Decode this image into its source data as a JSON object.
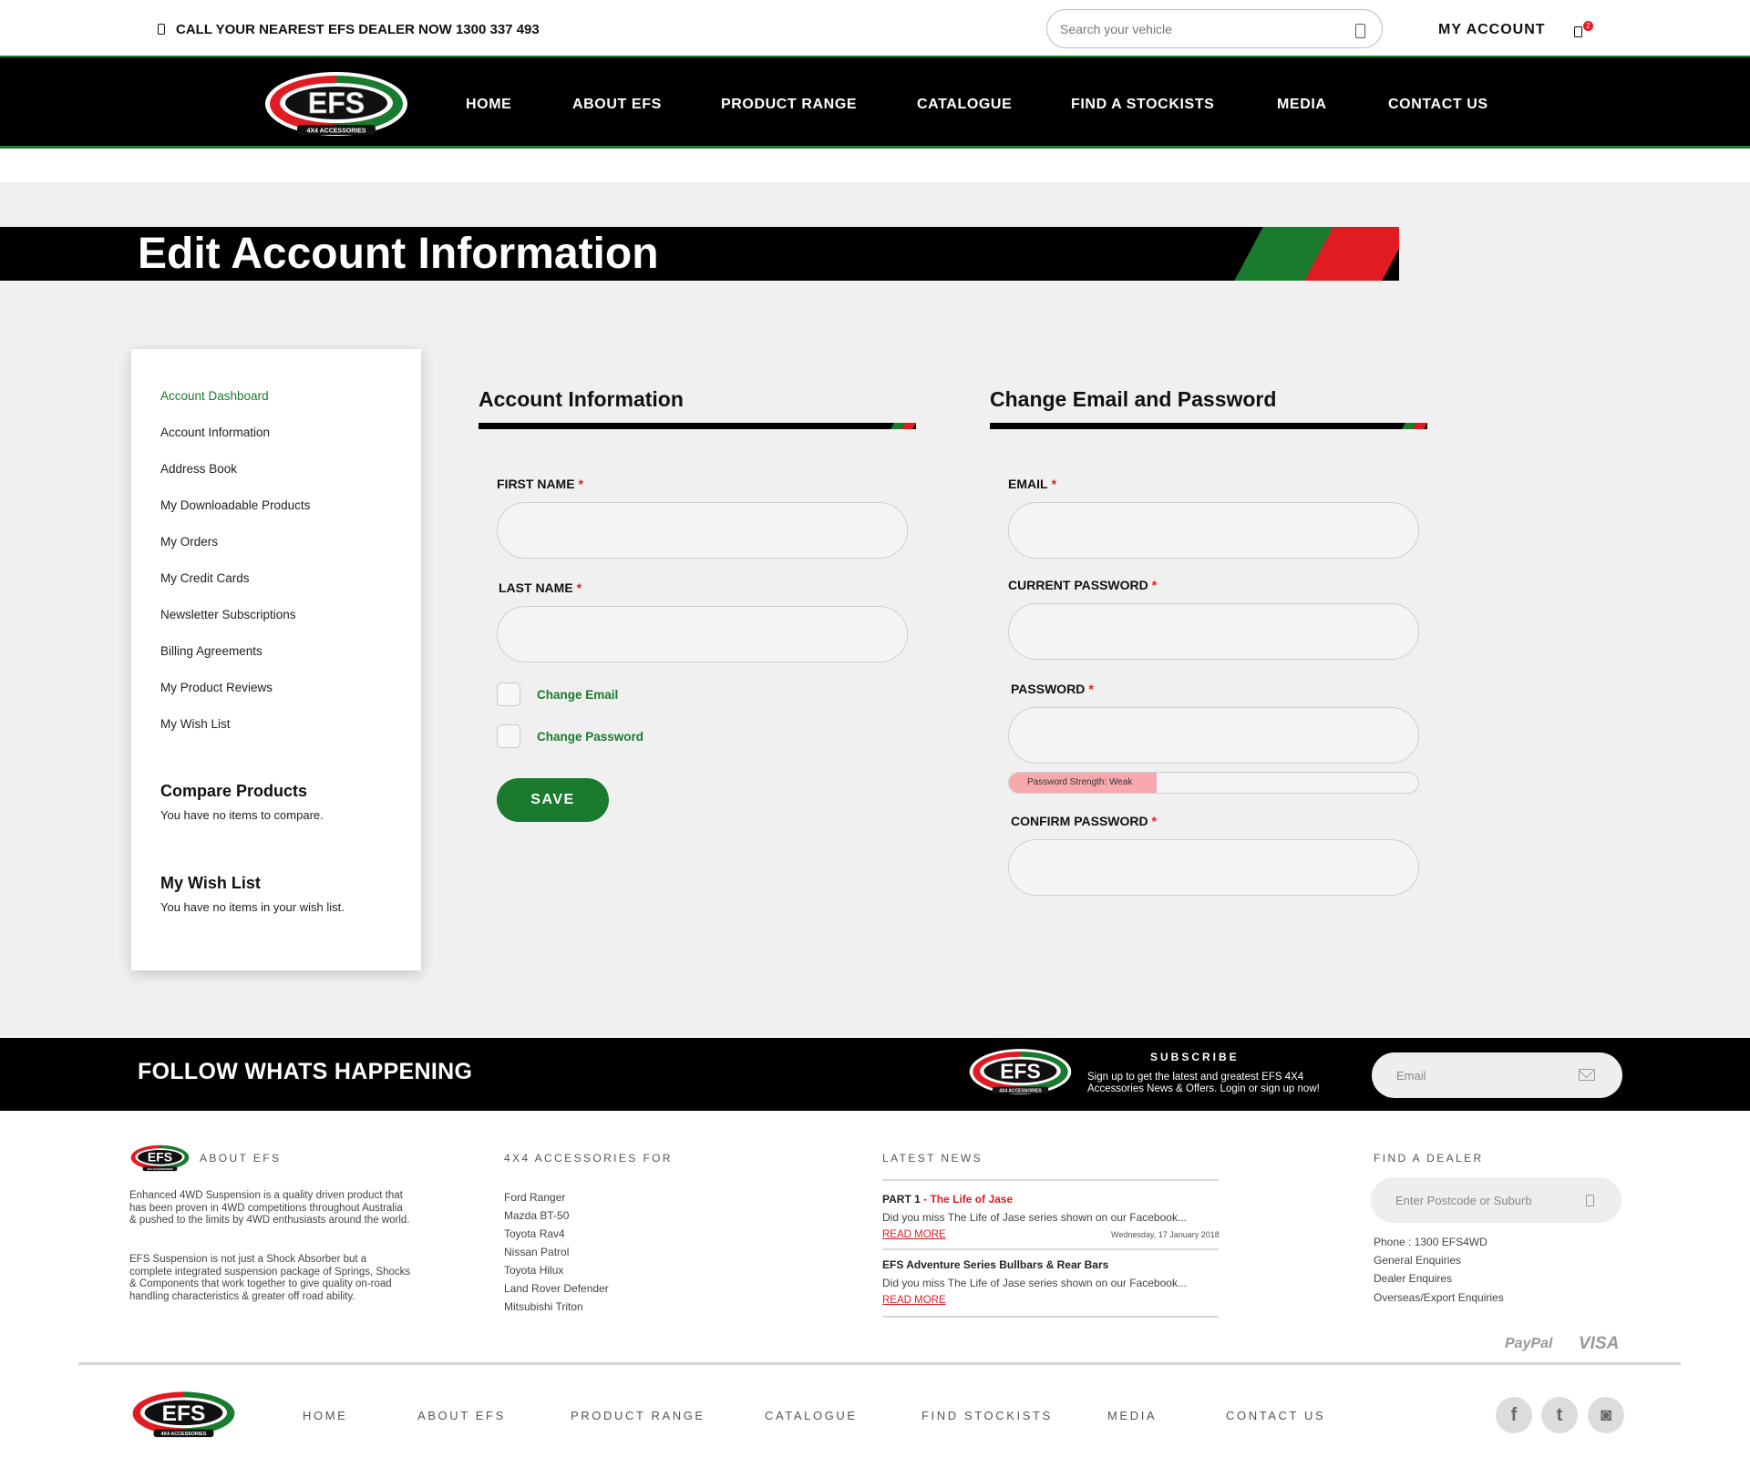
{
  "header": {
    "call_text": "CALL YOUR NEAREST EFS DEALER NOW 1300 337 493",
    "search_placeholder": "Search your vehicle",
    "my_account": "MY ACCOUNT",
    "cart_count": "2"
  },
  "logo": {
    "brand": "EFS",
    "tagline": "4X4 ACCESSORIES"
  },
  "nav": [
    "HOME",
    "ABOUT EFS",
    "PRODUCT RANGE",
    "CATALOGUE",
    "FIND A STOCKISTS",
    "MEDIA",
    "CONTACT US"
  ],
  "page_title": "Edit Account Information",
  "sidebar": {
    "links": [
      "Account Dashboard",
      "Account Information",
      "Address Book",
      "My Downloadable Products",
      "My Orders",
      "My Credit Cards",
      "Newsletter Subscriptions",
      "Billing Agreements",
      "My Product Reviews",
      "My Wish List"
    ],
    "compare_title": "Compare Products",
    "compare_text": "You have no items to compare.",
    "wishlist_title": "My Wish List",
    "wishlist_text": "You have no items in your wish list."
  },
  "account_info": {
    "title": "Account Information",
    "first_name_label": "FIRST NAME",
    "last_name_label": "LAST NAME",
    "first_name_value": "",
    "last_name_value": "",
    "change_email_label": "Change Email",
    "change_password_label": "Change Password",
    "save_label": "SAVE"
  },
  "change_email_password": {
    "title": "Change Email and Password",
    "email_label": "EMAIL",
    "current_password_label": "CURRENT PASSWORD",
    "password_label": "PASSWORD",
    "confirm_password_label": "CONFIRM PASSWORD",
    "strength_text": "Password Strength: Weak",
    "strength_fraction": 0.36
  },
  "required_mark": "*",
  "follow": {
    "heading": "FOLLOW WHATS HAPPENING",
    "subscribe_title": "SUBSCRIBE",
    "subscribe_text": "Sign up to get the latest and greatest EFS 4X4 Accessories News & Offers. Login or sign up now!",
    "email_placeholder": "Email"
  },
  "footer": {
    "about_title": "ABOUT EFS",
    "about_p1": "Enhanced 4WD Suspension is a quality driven product that has been proven in 4WD competitions throughout Australia & pushed to the limits by 4WD enthusiasts around the world.",
    "about_p2": "EFS Suspension is not just a Shock Absorber but a complete integrated suspension package of Springs, Shocks & Components that work together to give quality on-road handling characteristics & greater off road ability.",
    "accessories_title": "4X4 ACCESSORIES FOR",
    "accessories": [
      "Ford Ranger",
      "Mazda BT-50",
      "Toyota Rav4",
      "Nissan Patrol",
      "Toyota Hilux",
      "Land Rover Defender",
      "Mitsubishi Triton"
    ],
    "news_title": "LATEST NEWS",
    "news": [
      {
        "title_a": "PART 1",
        "title_b": " - The Life of Jase",
        "excerpt": "Did you miss The Life of Jase series shown on our Facebook...",
        "more": "READ MORE",
        "date": "Wednesday, 17 January 2018"
      },
      {
        "title_a": "",
        "title_b": "EFS Adventure Series Bullbars & Rear Bars",
        "excerpt": "Did you miss The Life of Jase series shown on our Facebook...",
        "more": "READ MORE",
        "date": ""
      }
    ],
    "dealer_title": "FIND A DEALER",
    "dealer_placeholder": "Enter Postcode or Suburb",
    "dealer_links": [
      "Phone : 1300 EFS4WD",
      "General Enquiries",
      "Dealer Enquires",
      "Overseas/Export Enquiries"
    ],
    "payment": [
      "PayPal",
      "VISA"
    ],
    "bottom_nav": [
      "HOME",
      "ABOUT EFS",
      "PRODUCT RANGE",
      "CATALOGUE",
      "FIND STOCKISTS",
      "MEDIA",
      "CONTACT US"
    ],
    "social": [
      {
        "name": "facebook",
        "glyph": "f"
      },
      {
        "name": "twitter",
        "glyph": "t"
      },
      {
        "name": "instagram",
        "glyph": "◙"
      }
    ]
  },
  "colors": {
    "brand_green": "#1a7a2e",
    "brand_red": "#e11b22",
    "black": "#000000",
    "content_bg": "#f0f0f0"
  }
}
